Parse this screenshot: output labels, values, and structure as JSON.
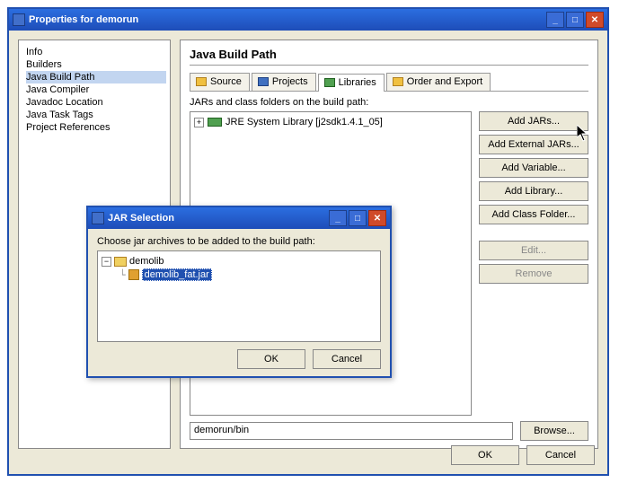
{
  "window": {
    "title": "Properties for demorun"
  },
  "nav": {
    "items": [
      "Info",
      "Builders",
      "Java Build Path",
      "Java Compiler",
      "Javadoc Location",
      "Java Task Tags",
      "Project References"
    ],
    "selected": 2
  },
  "panel": {
    "title": "Java Build Path",
    "section_label": "JARs and class folders on the build path:",
    "tree_item": "JRE System Library [j2sdk1.4.1_05]",
    "output_value": "demorun/bin",
    "browse_label": "Browse..."
  },
  "tabs": [
    {
      "label": "Source"
    },
    {
      "label": "Projects"
    },
    {
      "label": "Libraries"
    },
    {
      "label": "Order and Export"
    }
  ],
  "active_tab": 2,
  "buttons": {
    "add_jars": "Add JARs...",
    "add_ext": "Add External JARs...",
    "add_var": "Add Variable...",
    "add_lib": "Add Library...",
    "add_cf": "Add Class Folder...",
    "edit": "Edit...",
    "remove": "Remove"
  },
  "bottom": {
    "ok": "OK",
    "cancel": "Cancel"
  },
  "dialog": {
    "title": "JAR Selection",
    "prompt": "Choose jar archives to be added to the build path:",
    "folder": "demolib",
    "file": "demolib_fat.jar",
    "ok": "OK",
    "cancel": "Cancel"
  }
}
